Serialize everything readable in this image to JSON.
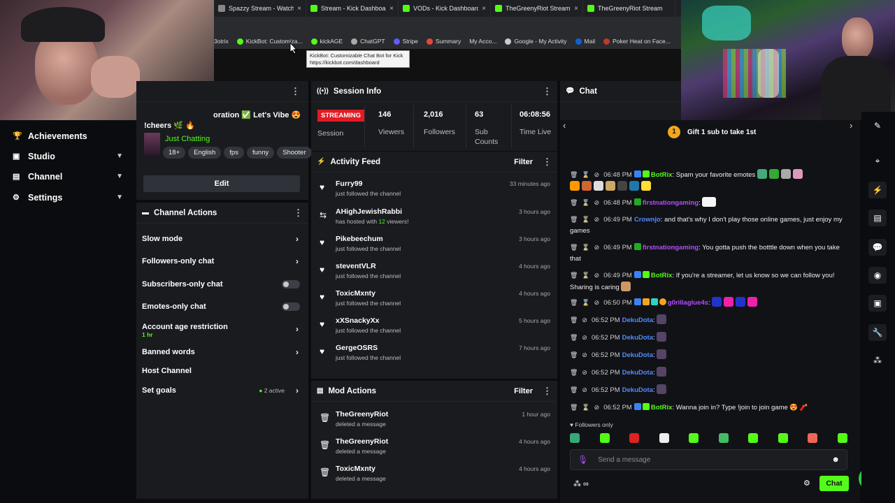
{
  "browser": {
    "tabs": [
      {
        "title": "Spazzy Stream - Watch",
        "icon_color": "#888888"
      },
      {
        "title": "Stream - Kick Dashboard",
        "icon_color": "#53fc18"
      },
      {
        "title": "VODs - Kick Dashboard",
        "icon_color": "#53fc18"
      },
      {
        "title": "TheGreenyRiot Stream - Wa",
        "icon_color": "#53fc18"
      },
      {
        "title": "TheGreenyRiot Stream",
        "icon_color": "#53fc18"
      }
    ],
    "bookmarks": [
      "3otrix",
      "KickBot: Customiza...",
      "kickAGE",
      "ChatGPT",
      "Stripe",
      "Summary",
      "My Acco...",
      "Google - My Activity",
      "Mail",
      "Poker Heat on Face..."
    ],
    "tooltip_line1": "KickBot: Customizable Chat Bot for Kick",
    "tooltip_line2": "https://kickbot.com/dashboard"
  },
  "sidebar": {
    "items": [
      {
        "label": "Achievements",
        "icon": "trophy-icon"
      },
      {
        "label": "Studio",
        "icon": "studio-icon"
      },
      {
        "label": "Channel",
        "icon": "channel-icon"
      },
      {
        "label": "Settings",
        "icon": "gear-icon"
      }
    ]
  },
  "stream_info": {
    "title_line1": "oration ✅ Let's Vibe 😍",
    "title_line2": "!cheers 🌿 🔥",
    "category": "Just Chatting",
    "tags": [
      "18+",
      "English",
      "fps",
      "funny",
      "Shooter"
    ],
    "edit_label": "Edit"
  },
  "channel_actions": {
    "title": "Channel Actions",
    "rows": [
      {
        "label": "Slow mode"
      },
      {
        "label": "Followers-only chat"
      },
      {
        "label": "Subscribers-only chat"
      },
      {
        "label": "Emotes-only chat"
      },
      {
        "label": "Account age restriction",
        "sub": "1 hr"
      },
      {
        "label": "Banned words"
      },
      {
        "label": "Host Channel"
      },
      {
        "label": "Set goals",
        "sub": "2 active"
      }
    ]
  },
  "session": {
    "title": "Session Info",
    "status": "STREAMING",
    "status_label": "Session",
    "stats": [
      {
        "value": "146",
        "label": "Viewers"
      },
      {
        "value": "2,016",
        "label": "Followers"
      },
      {
        "value": "63",
        "label": "Sub Counts"
      },
      {
        "value": "06:08:56",
        "label": "Time Live"
      }
    ]
  },
  "activity": {
    "title": "Activity Feed",
    "filter": "Filter",
    "items": [
      {
        "name": "Furry99",
        "sub": "just followed the channel",
        "time": "33 minutes ago"
      },
      {
        "name": "AHighJewishRabbi",
        "sub_pre": "has hosted with ",
        "sub_num": "12",
        "sub_post": " viewers!",
        "time": "3 hours ago"
      },
      {
        "name": "Pikebeechum",
        "sub": "just followed the channel",
        "time": "3 hours ago"
      },
      {
        "name": "steventVLR",
        "sub": "just followed the channel",
        "time": "4 hours ago"
      },
      {
        "name": "ToxicMxnty",
        "sub": "just followed the channel",
        "time": "4 hours ago"
      },
      {
        "name": "xXSnackyXx",
        "sub": "just followed the channel",
        "time": "5 hours ago"
      },
      {
        "name": "GergeOSRS",
        "sub": "just followed the channel",
        "time": "7 hours ago"
      }
    ]
  },
  "mod_actions": {
    "title": "Mod Actions",
    "filter": "Filter",
    "items": [
      {
        "name": "TheGreenyRiot",
        "sub": "deleted a message",
        "time": "1 hour ago"
      },
      {
        "name": "TheGreenyRiot",
        "sub": "deleted a message",
        "time": "4 hours ago"
      },
      {
        "name": "ToxicMxnty",
        "sub": "deleted a message",
        "time": "4 hours ago"
      }
    ]
  },
  "chat": {
    "title": "Chat",
    "pinned": "Gift 1 sub to take 1st",
    "pinned_badge": "1",
    "followers_only": "Followers only",
    "placeholder": "Send a message",
    "send_label": "Chat",
    "messages": [
      {
        "time": "06:48 PM",
        "user": "BotRix",
        "color": "#53fc18",
        "text": "Spam your favorite emotes"
      },
      {
        "time": "06:48 PM",
        "user": "firstnationgaming",
        "color": "#b44dff",
        "text": ""
      },
      {
        "time": "06:49 PM",
        "user": "Crownjo",
        "color": "#4f8cff",
        "text": "and that's why I don't play those online games, just enjoy my games"
      },
      {
        "time": "06:49 PM",
        "user": "firstnationgaming",
        "color": "#b44dff",
        "text": "You gotta push the botttle down when you take that"
      },
      {
        "time": "06:49 PM",
        "user": "BotRix",
        "color": "#53fc18",
        "text": "If you're a streamer, let us know so we can follow you! Sharing is caring"
      },
      {
        "time": "06:50 PM",
        "user": "g0rillaglue4s",
        "color": "#b44dff",
        "text": ""
      },
      {
        "time": "06:52 PM",
        "user": "DekuDota",
        "color": "#4f8cff",
        "text": ""
      },
      {
        "time": "06:52 PM",
        "user": "DekuDota",
        "color": "#4f8cff",
        "text": ""
      },
      {
        "time": "06:52 PM",
        "user": "DekuDota",
        "color": "#4f8cff",
        "text": ""
      },
      {
        "time": "06:52 PM",
        "user": "DekuDota",
        "color": "#4f8cff",
        "text": ""
      },
      {
        "time": "06:52 PM",
        "user": "DekuDota",
        "color": "#4f8cff",
        "text": ""
      },
      {
        "time": "06:52 PM",
        "user": "BotRix",
        "color": "#53fc18",
        "text": "Wanna join in? Type !join to join game"
      }
    ]
  },
  "colors": {
    "brand": "#53fc18",
    "live": "#e01b24",
    "panel": "#191b1f"
  }
}
